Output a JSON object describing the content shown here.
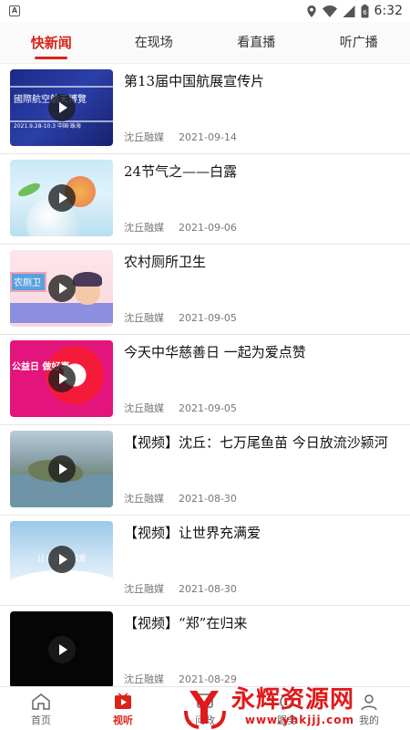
{
  "status_bar": {
    "time": "6:32",
    "icons": [
      "app-a-icon",
      "location-icon",
      "wifi-icon",
      "signal-icon",
      "battery-icon"
    ]
  },
  "tabs": [
    {
      "label": "快新闻",
      "active": true
    },
    {
      "label": "在现场",
      "active": false
    },
    {
      "label": "看直播",
      "active": false
    },
    {
      "label": "听广播",
      "active": false
    }
  ],
  "items": [
    {
      "title": "第13届中国航展宣传片",
      "source": "沈丘融媒",
      "date": "2021-09-14",
      "thumb_text": "國際航空航天博覽",
      "thumb_sub": "2021.9.28-10.3  中国·珠海"
    },
    {
      "title": "24节气之——白露",
      "source": "沈丘融媒",
      "date": "2021-09-06"
    },
    {
      "title": "农村厕所卫生",
      "source": "沈丘融媒",
      "date": "2021-09-05",
      "thumb_text": "农厕卫"
    },
    {
      "title": "今天中华慈善日 一起为爱点赞",
      "source": "沈丘融媒",
      "date": "2021-09-05",
      "thumb_text": "公益日 做好事"
    },
    {
      "title": "【视频】沈丘：七万尾鱼苗 今日放流沙颍河",
      "source": "沈丘融媒",
      "date": "2021-08-30"
    },
    {
      "title": "【视频】让世界充满爱",
      "source": "沈丘融媒",
      "date": "2021-08-30",
      "thumb_text": "让世界充满爱"
    },
    {
      "title": "【视频】“郑”在归来",
      "source": "沈丘融媒",
      "date": "2021-08-29"
    }
  ],
  "bottom_nav": [
    {
      "label": "首页",
      "icon": "home-icon",
      "active": false
    },
    {
      "label": "视听",
      "icon": "video-icon",
      "active": true
    },
    {
      "label": "问政",
      "icon": "question-icon",
      "active": false
    },
    {
      "label": "服务",
      "icon": "service-icon",
      "active": false
    },
    {
      "label": "我的",
      "icon": "user-icon",
      "active": false
    }
  ],
  "watermark": {
    "title": "永辉资源网",
    "url": "www.yhkjjj.com"
  },
  "colors": {
    "accent": "#d9241b",
    "watermark": "#e0191b"
  }
}
